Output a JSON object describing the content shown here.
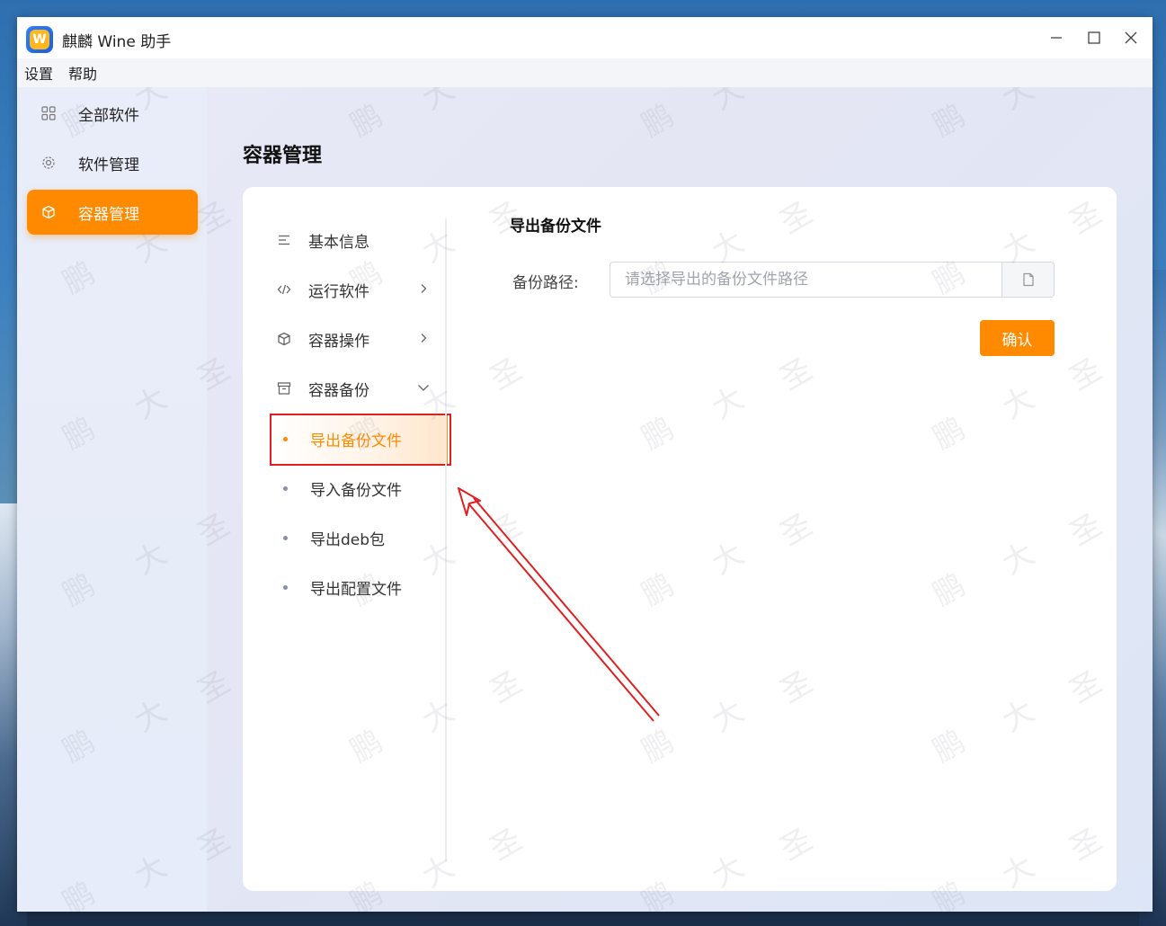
{
  "window": {
    "title": "麒麟 Wine 助手",
    "logo_letter": "W",
    "minimize_glyph": "—",
    "maximize_glyph": "☐",
    "close_glyph": "✕"
  },
  "menubar": {
    "items": [
      "设置",
      "帮助"
    ]
  },
  "sidebar": {
    "items": [
      {
        "label": "全部软件",
        "icon": "grid-icon",
        "active": false
      },
      {
        "label": "软件管理",
        "icon": "gear-icon",
        "active": false
      },
      {
        "label": "容器管理",
        "icon": "cube-icon",
        "active": true
      }
    ]
  },
  "main": {
    "title": "容器管理",
    "subnav": {
      "items": [
        {
          "label": "基本信息",
          "icon": "list-icon"
        },
        {
          "label": "运行软件",
          "icon": "code-icon",
          "chevron": "chevron-right-icon"
        },
        {
          "label": "容器操作",
          "icon": "cube-icon",
          "chevron": "chevron-right-icon"
        },
        {
          "label": "容器备份",
          "icon": "archive-icon",
          "chevron": "chevron-down-icon"
        }
      ],
      "backup_children": [
        {
          "label": "导出备份文件",
          "active": true
        },
        {
          "label": "导入备份文件",
          "active": false
        },
        {
          "label": "导出deb包",
          "active": false
        },
        {
          "label": "导出配置文件",
          "active": false
        }
      ]
    },
    "export_panel": {
      "section_title": "导出备份文件",
      "path_label": "备份路径:",
      "path_value": "",
      "path_placeholder": "请选择导出的备份文件路径",
      "file_icon": "file-icon",
      "confirm_label": "确认"
    }
  },
  "colors": {
    "accent": "#ff8a00",
    "annotation": "#e02020"
  },
  "watermark": [
    "圣",
    "大",
    "鹏"
  ]
}
